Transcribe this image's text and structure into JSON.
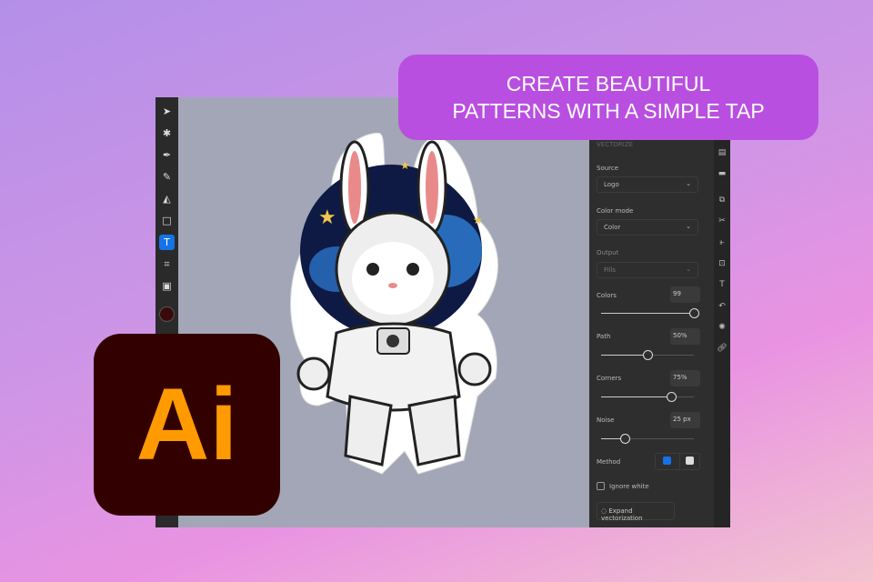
{
  "banner": {
    "line1": "CREATE BEAUTIFUL",
    "line2": "PATTERNS WITH A SIMPLE TAP"
  },
  "logo": {
    "text": "Ai",
    "bg": "#330000",
    "fg": "#ff9a00"
  },
  "panel": {
    "title": "VECTORIZE",
    "source_label": "Source",
    "source_value": "Logo",
    "color_mode_label": "Color mode",
    "color_mode_value": "Color",
    "output_label": "Output",
    "output_value": "Fills",
    "colors_label": "Colors",
    "colors_value": "99",
    "colors_level": 1.0,
    "path_label": "Path",
    "path_value": "50%",
    "path_level": 0.5,
    "corners_label": "Corners",
    "corners_value": "75%",
    "corners_level": 0.75,
    "noise_label": "Noise",
    "noise_value": "25 px",
    "noise_level": 0.25,
    "method_label": "Method",
    "ignore_white_label": "Ignore white",
    "ignore_white_checked": false,
    "expand_label": "Expand vectorization"
  },
  "toolbar": {
    "active_tool": "type",
    "fill_color": "#3a0a0a"
  }
}
